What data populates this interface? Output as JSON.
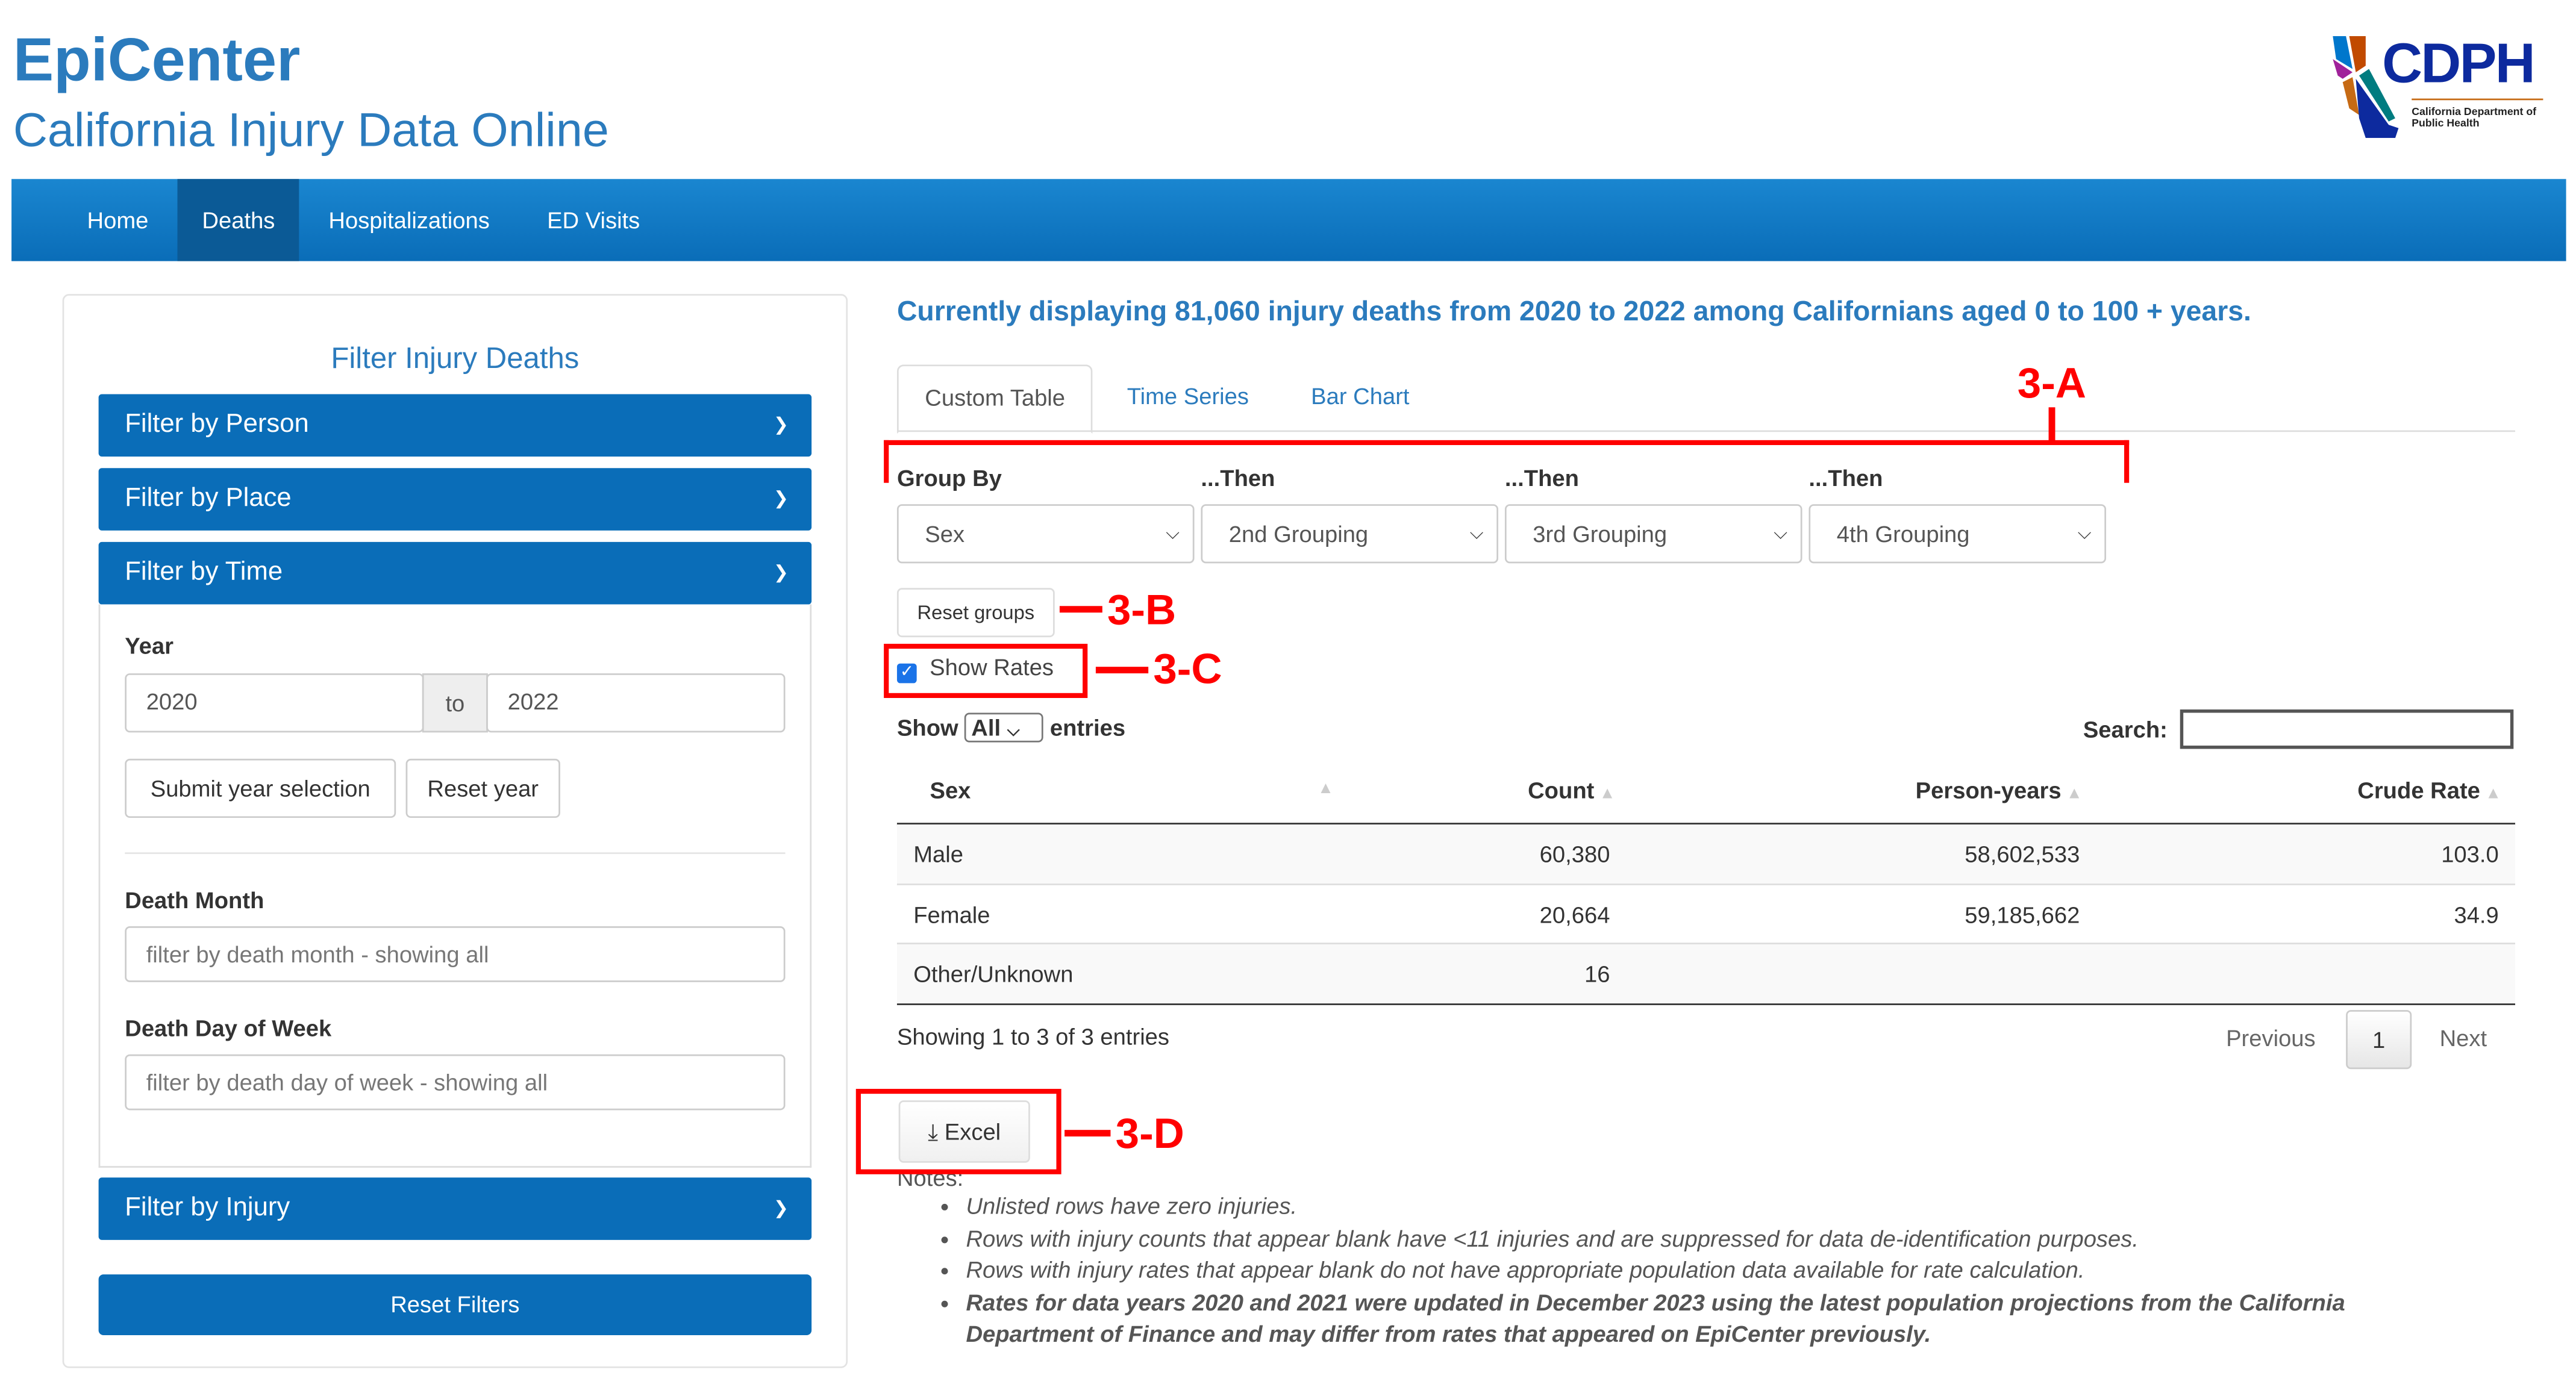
{
  "header": {
    "title": "EpiCenter",
    "subtitle": "California Injury Data Online",
    "logo_text": "CDPH",
    "logo_subtext": "California Department of Public Health"
  },
  "nav": {
    "items": [
      {
        "label": "Home"
      },
      {
        "label": "Deaths",
        "active": true
      },
      {
        "label": "Hospitalizations"
      },
      {
        "label": "ED Visits"
      }
    ]
  },
  "sidebar": {
    "title": "Filter Injury Deaths",
    "sections": [
      "Filter by Person",
      "Filter by Place",
      "Filter by Time",
      "Filter by Injury"
    ],
    "year_label": "Year",
    "year_from": "2020",
    "year_to_label": "to",
    "year_to": "2022",
    "submit_year": "Submit year selection",
    "reset_year": "Reset year",
    "death_month_label": "Death Month",
    "death_month_placeholder": "filter by death month - showing all",
    "death_dow_label": "Death Day of Week",
    "death_dow_placeholder": "filter by death day of week - showing all",
    "reset_filters": "Reset Filters"
  },
  "main": {
    "summary": "Currently displaying 81,060 injury deaths from 2020 to 2022 among Californians aged 0 to 100 + years.",
    "tabs": [
      {
        "label": "Custom Table",
        "active": true
      },
      {
        "label": "Time Series"
      },
      {
        "label": "Bar Chart"
      }
    ],
    "group_labels": [
      "Group By",
      "...Then",
      "...Then",
      "...Then"
    ],
    "group_values": [
      "Sex",
      "2nd Grouping",
      "3rd Grouping",
      "4th Grouping"
    ],
    "reset_groups": "Reset groups",
    "show_rates": {
      "label": "Show Rates",
      "checked": true
    },
    "show_label": "Show",
    "show_value": "All",
    "entries_label": "entries",
    "search_label": "Search:",
    "search_value": "",
    "table": {
      "columns": [
        "Sex",
        "Count",
        "Person-years",
        "Crude Rate"
      ],
      "rows": [
        [
          "Male",
          "60,380",
          "58,602,533",
          "103.0"
        ],
        [
          "Female",
          "20,664",
          "59,185,662",
          "34.9"
        ],
        [
          "Other/Unknown",
          "16",
          "",
          ""
        ]
      ]
    },
    "info": "Showing 1 to 3 of 3 entries",
    "pagination": {
      "previous": "Previous",
      "page": "1",
      "next": "Next"
    },
    "excel": "Excel",
    "notes_title": "Notes:",
    "notes": [
      "Unlisted rows have zero injuries.",
      "Rows with injury counts that appear blank have <11 injuries and are suppressed for data de-identification purposes.",
      "Rows with injury rates that appear blank do not have appropriate population data available for rate calculation.",
      "Rates for data years 2020 and 2021 were updated in December 2023 using the latest population projections from the California Department of Finance and may differ from rates that appeared on EpiCenter previously."
    ]
  },
  "annotations": {
    "a": "3-A",
    "b": "3-B",
    "c": "3-C",
    "d": "3-D"
  },
  "colors": {
    "brand": "#2b7bbd",
    "nav": "#0a6db8",
    "annotation": "#ff0000"
  }
}
